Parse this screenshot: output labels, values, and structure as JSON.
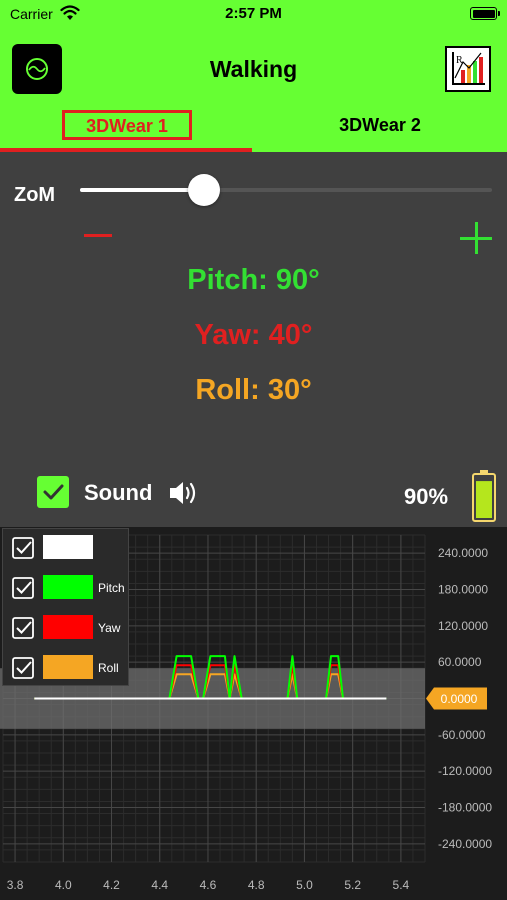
{
  "status_bar": {
    "carrier": "Carrier",
    "time": "2:57 PM"
  },
  "nav": {
    "title": "Walking",
    "app_icon": "app-logo-icon",
    "chart_icon": "chart-report-icon"
  },
  "tabs": [
    {
      "label": "3DWear 1",
      "selected": true
    },
    {
      "label": "3DWear 2",
      "selected": false
    }
  ],
  "zoom": {
    "label": "ZoM",
    "value": 0.3
  },
  "readings": {
    "pitch": "Pitch: 90°",
    "yaw": "Yaw: 40°",
    "roll": "Roll: 30°"
  },
  "sound": {
    "label": "Sound",
    "checked": true
  },
  "device_battery": {
    "percent_label": "90%",
    "level": 0.9
  },
  "colors": {
    "accent": "#66ff33",
    "pitch": "#33e033",
    "yaw": "#e02020",
    "roll": "#f5a623",
    "series1": "#ffffff"
  },
  "legend": [
    {
      "label": "",
      "color": "#ffffff",
      "checked": true
    },
    {
      "label": "Pitch",
      "color": "#00ff00",
      "checked": true
    },
    {
      "label": "Yaw",
      "color": "#ff0000",
      "checked": true
    },
    {
      "label": "Roll",
      "color": "#f5a623",
      "checked": true
    }
  ],
  "chart_data": {
    "type": "line",
    "xlim": [
      3.75,
      5.5
    ],
    "ylim": [
      -270,
      270
    ],
    "x_ticks": [
      "3.8",
      "4.0",
      "4.2",
      "4.4",
      "4.6",
      "4.8",
      "5.0",
      "5.2",
      "5.4"
    ],
    "x_tick_values": [
      3.8,
      4.0,
      4.2,
      4.4,
      4.6,
      4.8,
      5.0,
      5.2,
      5.4
    ],
    "y_ticks": [
      "240.0000",
      "180.0000",
      "120.0000",
      "60.0000",
      "0.0000",
      "-60.0000",
      "-120.0000",
      "-180.0000",
      "-240.0000"
    ],
    "y_tick_values": [
      240,
      180,
      120,
      60,
      0,
      -60,
      -120,
      -180,
      -240
    ],
    "current_value_label": "0.0000",
    "band": [
      -50,
      50
    ],
    "series": [
      {
        "color": "#ffffff",
        "x": [
          3.88,
          4.44,
          4.46,
          4.48,
          4.5,
          4.52,
          4.54,
          4.56,
          4.58,
          4.6,
          4.62,
          4.64,
          4.66,
          4.68,
          4.7,
          5.34
        ],
        "y": [
          0,
          0,
          0,
          0,
          0,
          0,
          0,
          0,
          0,
          0,
          0,
          0,
          0,
          0,
          0,
          0
        ]
      },
      {
        "name": "Pitch",
        "color": "#00ff00",
        "x": [
          3.88,
          4.44,
          4.47,
          4.53,
          4.56,
          4.58,
          4.61,
          4.67,
          4.69,
          4.71,
          4.74,
          4.93,
          4.95,
          4.97,
          5.09,
          5.11,
          5.14,
          5.16,
          5.34
        ],
        "y": [
          0,
          0,
          70,
          70,
          0,
          0,
          70,
          70,
          0,
          70,
          0,
          0,
          70,
          0,
          0,
          70,
          70,
          0,
          0
        ]
      },
      {
        "name": "Yaw",
        "color": "#ff0000",
        "x": [
          3.88,
          4.44,
          4.47,
          4.53,
          4.56,
          4.58,
          4.61,
          4.67,
          4.69,
          4.71,
          4.74,
          4.93,
          4.95,
          4.97,
          5.09,
          5.11,
          5.14,
          5.16,
          5.34
        ],
        "y": [
          0,
          0,
          55,
          55,
          0,
          0,
          55,
          55,
          0,
          55,
          0,
          0,
          55,
          0,
          0,
          55,
          55,
          0,
          0
        ]
      },
      {
        "name": "Roll",
        "color": "#f5a623",
        "x": [
          3.88,
          4.44,
          4.47,
          4.53,
          4.56,
          4.58,
          4.61,
          4.67,
          4.69,
          4.71,
          4.74,
          4.93,
          4.95,
          4.97,
          5.09,
          5.11,
          5.14,
          5.16,
          5.34
        ],
        "y": [
          0,
          0,
          40,
          40,
          0,
          0,
          40,
          40,
          0,
          40,
          0,
          0,
          40,
          0,
          0,
          40,
          40,
          0,
          0
        ]
      }
    ]
  }
}
